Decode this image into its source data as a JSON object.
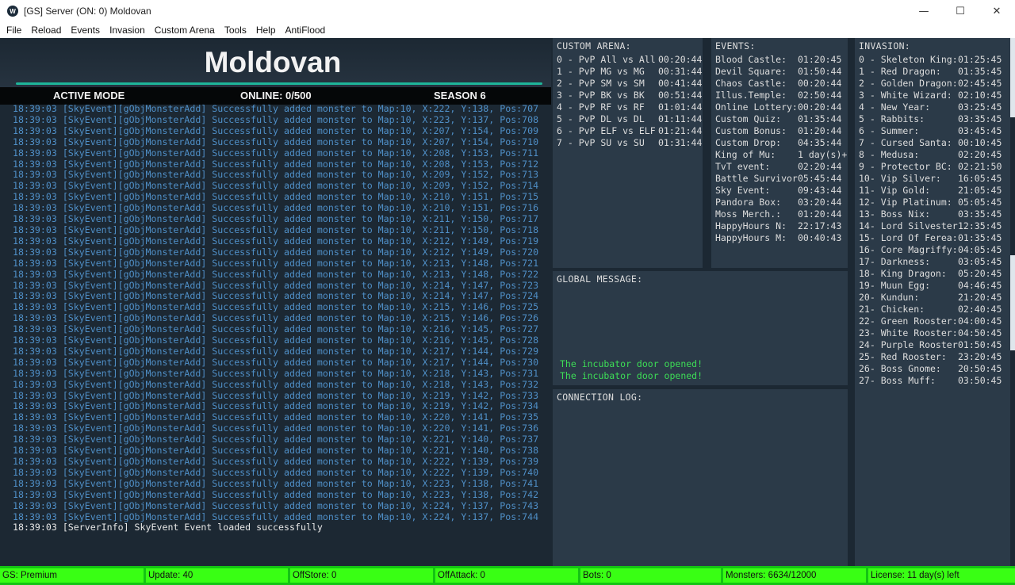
{
  "window": {
    "title": "[GS] Server (ON: 0) Moldovan",
    "minimize": "—",
    "maximize": "☐",
    "close": "✕",
    "app_icon": "W"
  },
  "menu": [
    "File",
    "Reload",
    "Events",
    "Invasion",
    "Custom Arena",
    "Tools",
    "Help",
    "AntiFlood"
  ],
  "header": {
    "server_name": "Moldovan",
    "mode": "ACTIVE MODE",
    "online": "ONLINE: 0/500",
    "season": "SEASON 6"
  },
  "log": [
    "18:39:03 [SkyEvent][gObjMonsterAdd] Successfully added monster to Map:10, X:222, Y:138, Pos:707",
    "18:39:03 [SkyEvent][gObjMonsterAdd] Successfully added monster to Map:10, X:223, Y:137, Pos:708",
    "18:39:03 [SkyEvent][gObjMonsterAdd] Successfully added monster to Map:10, X:207, Y:154, Pos:709",
    "18:39:03 [SkyEvent][gObjMonsterAdd] Successfully added monster to Map:10, X:207, Y:154, Pos:710",
    "18:39:03 [SkyEvent][gObjMonsterAdd] Successfully added monster to Map:10, X:208, Y:153, Pos:711",
    "18:39:03 [SkyEvent][gObjMonsterAdd] Successfully added monster to Map:10, X:208, Y:153, Pos:712",
    "18:39:03 [SkyEvent][gObjMonsterAdd] Successfully added monster to Map:10, X:209, Y:152, Pos:713",
    "18:39:03 [SkyEvent][gObjMonsterAdd] Successfully added monster to Map:10, X:209, Y:152, Pos:714",
    "18:39:03 [SkyEvent][gObjMonsterAdd] Successfully added monster to Map:10, X:210, Y:151, Pos:715",
    "18:39:03 [SkyEvent][gObjMonsterAdd] Successfully added monster to Map:10, X:210, Y:151, Pos:716",
    "18:39:03 [SkyEvent][gObjMonsterAdd] Successfully added monster to Map:10, X:211, Y:150, Pos:717",
    "18:39:03 [SkyEvent][gObjMonsterAdd] Successfully added monster to Map:10, X:211, Y:150, Pos:718",
    "18:39:03 [SkyEvent][gObjMonsterAdd] Successfully added monster to Map:10, X:212, Y:149, Pos:719",
    "18:39:03 [SkyEvent][gObjMonsterAdd] Successfully added monster to Map:10, X:212, Y:149, Pos:720",
    "18:39:03 [SkyEvent][gObjMonsterAdd] Successfully added monster to Map:10, X:213, Y:148, Pos:721",
    "18:39:03 [SkyEvent][gObjMonsterAdd] Successfully added monster to Map:10, X:213, Y:148, Pos:722",
    "18:39:03 [SkyEvent][gObjMonsterAdd] Successfully added monster to Map:10, X:214, Y:147, Pos:723",
    "18:39:03 [SkyEvent][gObjMonsterAdd] Successfully added monster to Map:10, X:214, Y:147, Pos:724",
    "18:39:03 [SkyEvent][gObjMonsterAdd] Successfully added monster to Map:10, X:215, Y:146, Pos:725",
    "18:39:03 [SkyEvent][gObjMonsterAdd] Successfully added monster to Map:10, X:215, Y:146, Pos:726",
    "18:39:03 [SkyEvent][gObjMonsterAdd] Successfully added monster to Map:10, X:216, Y:145, Pos:727",
    "18:39:03 [SkyEvent][gObjMonsterAdd] Successfully added monster to Map:10, X:216, Y:145, Pos:728",
    "18:39:03 [SkyEvent][gObjMonsterAdd] Successfully added monster to Map:10, X:217, Y:144, Pos:729",
    "18:39:03 [SkyEvent][gObjMonsterAdd] Successfully added monster to Map:10, X:217, Y:144, Pos:730",
    "18:39:03 [SkyEvent][gObjMonsterAdd] Successfully added monster to Map:10, X:218, Y:143, Pos:731",
    "18:39:03 [SkyEvent][gObjMonsterAdd] Successfully added monster to Map:10, X:218, Y:143, Pos:732",
    "18:39:03 [SkyEvent][gObjMonsterAdd] Successfully added monster to Map:10, X:219, Y:142, Pos:733",
    "18:39:03 [SkyEvent][gObjMonsterAdd] Successfully added monster to Map:10, X:219, Y:142, Pos:734",
    "18:39:03 [SkyEvent][gObjMonsterAdd] Successfully added monster to Map:10, X:220, Y:141, Pos:735",
    "18:39:03 [SkyEvent][gObjMonsterAdd] Successfully added monster to Map:10, X:220, Y:141, Pos:736",
    "18:39:03 [SkyEvent][gObjMonsterAdd] Successfully added monster to Map:10, X:221, Y:140, Pos:737",
    "18:39:03 [SkyEvent][gObjMonsterAdd] Successfully added monster to Map:10, X:221, Y:140, Pos:738",
    "18:39:03 [SkyEvent][gObjMonsterAdd] Successfully added monster to Map:10, X:222, Y:139, Pos:739",
    "18:39:03 [SkyEvent][gObjMonsterAdd] Successfully added monster to Map:10, X:222, Y:139, Pos:740",
    "18:39:03 [SkyEvent][gObjMonsterAdd] Successfully added monster to Map:10, X:223, Y:138, Pos:741",
    "18:39:03 [SkyEvent][gObjMonsterAdd] Successfully added monster to Map:10, X:223, Y:138, Pos:742",
    "18:39:03 [SkyEvent][gObjMonsterAdd] Successfully added monster to Map:10, X:224, Y:137, Pos:743",
    "18:39:03 [SkyEvent][gObjMonsterAdd] Successfully added monster to Map:10, X:224, Y:137, Pos:744"
  ],
  "log_final": "18:39:03 [ServerInfo] SkyEvent Event loaded successfully",
  "custom_arena": {
    "title": "CUSTOM ARENA:",
    "rows": [
      {
        "name": "0 - PvP All vs All",
        "time": "00:20:44"
      },
      {
        "name": "1 - PvP MG vs MG",
        "time": "00:31:44"
      },
      {
        "name": "2 - PvP SM vs SM",
        "time": "00:41:44"
      },
      {
        "name": "3 - PvP BK vs BK",
        "time": "00:51:44"
      },
      {
        "name": "4 - PvP RF vs RF",
        "time": "01:01:44"
      },
      {
        "name": "5 - PvP DL vs DL",
        "time": "01:11:44"
      },
      {
        "name": "6 - PvP ELF vs ELF",
        "time": "01:21:44"
      },
      {
        "name": "7 - PvP SU vs SU",
        "time": "01:31:44"
      }
    ]
  },
  "events": {
    "title": "EVENTS:",
    "rows": [
      {
        "name": "Blood Castle:",
        "time": "01:20:45"
      },
      {
        "name": "Devil Square:",
        "time": "01:50:44"
      },
      {
        "name": "Chaos Castle:",
        "time": "00:20:44"
      },
      {
        "name": "Illus.Temple:",
        "time": "02:50:44"
      },
      {
        "name": "Online Lottery:",
        "time": "00:20:44"
      },
      {
        "name": "Custom Quiz:",
        "time": "01:35:44"
      },
      {
        "name": "Custom Bonus:",
        "time": "01:20:44"
      },
      {
        "name": "Custom Drop:",
        "time": "04:35:44"
      },
      {
        "name": "King of Mu:",
        "time": "1 day(s)+"
      },
      {
        "name": "TvT event:",
        "time": "02:20:44"
      },
      {
        "name": "Battle Survivor",
        "time": "05:45:44"
      },
      {
        "name": "Sky Event:",
        "time": "09:43:44"
      },
      {
        "name": "Pandora Box:",
        "time": "03:20:44"
      },
      {
        "name": "Moss Merch.:",
        "time": "01:20:44"
      },
      {
        "name": "HappyHours N:",
        "time": "22:17:43"
      },
      {
        "name": "HappyHours M:",
        "time": "00:40:43"
      }
    ]
  },
  "invasion": {
    "title": "INVASION:",
    "rows": [
      {
        "name": "0 - Skeleton King:",
        "time": "01:25:45"
      },
      {
        "name": "1 - Red Dragon:",
        "time": "01:35:45"
      },
      {
        "name": "2 - Golden Dragon:",
        "time": "02:45:45"
      },
      {
        "name": "3 - White Wizard:",
        "time": "02:10:45"
      },
      {
        "name": "4 - New Year:",
        "time": "03:25:45"
      },
      {
        "name": "5 - Rabbits:",
        "time": "03:35:45"
      },
      {
        "name": "6 - Summer:",
        "time": "03:45:45"
      },
      {
        "name": "7 - Cursed Santa:",
        "time": "00:10:45"
      },
      {
        "name": "8 - Medusa:",
        "time": "02:20:45"
      },
      {
        "name": "9 - Protector BC:",
        "time": "02:21:50"
      },
      {
        "name": "10- Vip Silver:",
        "time": "16:05:45"
      },
      {
        "name": "11- Vip Gold:",
        "time": "21:05:45"
      },
      {
        "name": "12- Vip Platinum:",
        "time": "05:05:45"
      },
      {
        "name": "13- Boss Nix:",
        "time": "03:35:45"
      },
      {
        "name": "14- Lord Silvester",
        "time": "12:35:45"
      },
      {
        "name": "15- Lord Of Ferea:",
        "time": "01:35:45"
      },
      {
        "name": "16- Core Magriffy:",
        "time": "04:05:45"
      },
      {
        "name": "17- Darkness:",
        "time": "03:05:45"
      },
      {
        "name": "18- King Dragon:",
        "time": "05:20:45"
      },
      {
        "name": "19- Muun Egg:",
        "time": "04:46:45"
      },
      {
        "name": "20- Kundun:",
        "time": "21:20:45"
      },
      {
        "name": "21- Chicken:",
        "time": "02:40:45"
      },
      {
        "name": "22- Green Rooster:",
        "time": "04:00:45"
      },
      {
        "name": "23- White Rooster:",
        "time": "04:50:45"
      },
      {
        "name": "24- Purple Rooster",
        "time": "01:50:45"
      },
      {
        "name": "25- Red Rooster:",
        "time": "23:20:45"
      },
      {
        "name": "26- Boss Gnome:",
        "time": "20:50:45"
      },
      {
        "name": "27- Boss Muff:",
        "time": "03:50:45"
      }
    ]
  },
  "global_message": {
    "title": "GLOBAL MESSAGE:",
    "lines": [
      "The incubator door opened!",
      "The incubator door opened!"
    ]
  },
  "connection_log": {
    "title": "CONNECTION LOG:"
  },
  "status": [
    "GS: Premium",
    "Update: 40",
    "OffStore: 0",
    "OffAttack: 0",
    "Bots: 0",
    "Monsters: 6634/12000",
    "License: 11 day(s) left"
  ],
  "colors": {
    "background": "#1c2833",
    "panel": "#2b3a48",
    "accent": "#1eb69a",
    "log_text": "#4f8fc7",
    "message_green": "#3ddc56",
    "status_green": "#39ff14"
  }
}
